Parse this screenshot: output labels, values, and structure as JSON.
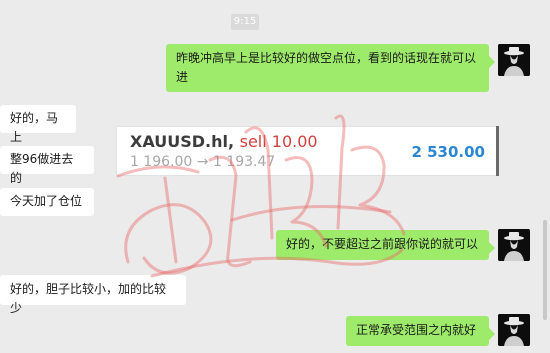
{
  "chat": {
    "time": "9:15",
    "messages": [
      {
        "side": "right",
        "text": "昨晚冲高早上是比较好的做空点位，看到的话现在就可以进"
      },
      {
        "side": "left",
        "text": "好的，马上"
      },
      {
        "side": "left",
        "text": "整96做进去的"
      },
      {
        "side": "left",
        "text": "今天加了仓位"
      },
      {
        "side": "right",
        "text": "好的，不要超过之前跟你说的就可以"
      },
      {
        "side": "left",
        "text": "好的，胆子比较小，加的比较少"
      },
      {
        "side": "right",
        "text": "正常承受范围之内就好"
      }
    ]
  },
  "trade_card": {
    "symbol": "XAUUSD.hl,",
    "action": "sell 10.00",
    "prices": "1 196.00 → 1 193.47",
    "profit": "2 530.00"
  },
  "colors": {
    "background": "#ebebeb",
    "outgoing_bubble": "#9eea6a",
    "incoming_bubble": "#ffffff",
    "sell": "#d14040",
    "profit": "#2c87d3"
  },
  "icons": {
    "avatar": "man-in-hat-silhouette",
    "watermark": "red-handwritten-signature"
  }
}
